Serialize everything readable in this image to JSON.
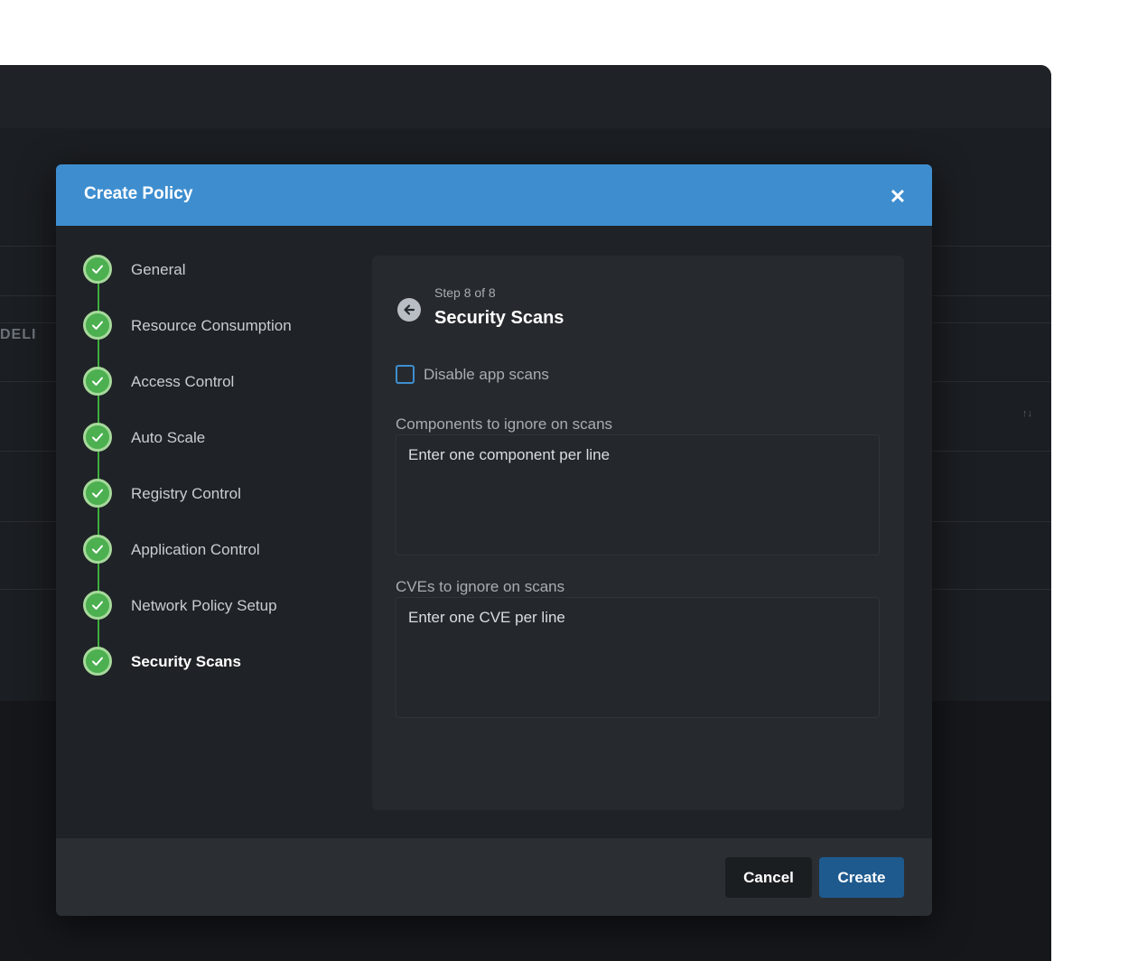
{
  "background": {
    "delete_label": "DELI",
    "sort_arrows": "↑↓"
  },
  "modal": {
    "title": "Create Policy",
    "close_symbol": "✕",
    "steps": [
      {
        "label": "General",
        "status": "complete"
      },
      {
        "label": "Resource Consumption",
        "status": "complete"
      },
      {
        "label": "Access Control",
        "status": "complete"
      },
      {
        "label": "Auto Scale",
        "status": "complete"
      },
      {
        "label": "Registry Control",
        "status": "complete"
      },
      {
        "label": "Application Control",
        "status": "complete"
      },
      {
        "label": "Network Policy Setup",
        "status": "complete"
      },
      {
        "label": "Security Scans",
        "status": "active"
      }
    ],
    "content": {
      "step_counter": "Step 8 of 8",
      "step_title": "Security Scans",
      "disable_scans_label": "Disable app scans",
      "disable_scans_checked": false,
      "components_label": "Components to ignore on scans",
      "components_placeholder": "Enter one component per line",
      "cves_label": "CVEs to ignore on scans",
      "cves_placeholder": "Enter one CVE per line"
    },
    "footer": {
      "cancel_label": "Cancel",
      "create_label": "Create"
    }
  },
  "colors": {
    "header_blue": "#3e8ecf",
    "step_green": "#4caf50",
    "create_button": "#1e5a8e"
  }
}
